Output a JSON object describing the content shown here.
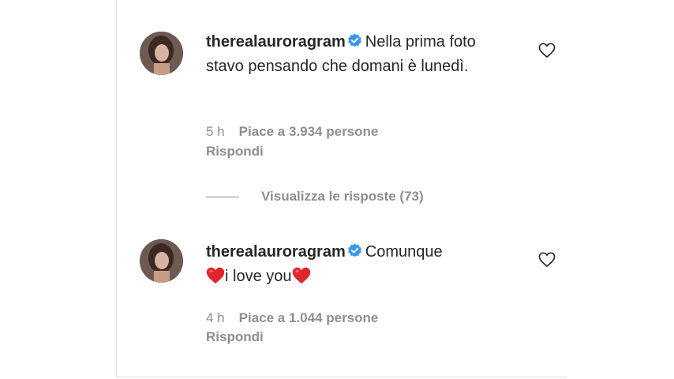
{
  "comments": [
    {
      "username": "therealauroragram",
      "text": "Nella prima foto stavo pensando che domani è lunedì.",
      "time": "5 h",
      "likes": "Piace a 3.934 persone",
      "reply": "Rispondi"
    },
    {
      "username": "therealauroragram",
      "text_before": "Comunque",
      "text_middle": "i love you",
      "time": "4 h",
      "likes": "Piace a 1.044 persone",
      "reply": "Rispondi"
    }
  ],
  "view_replies": "Visualizza le risposte (73)",
  "icons": {
    "verified": "verified-badge-icon",
    "like": "heart-outline-icon",
    "emoji": "red-heart-emoji"
  },
  "colors": {
    "text": "#262626",
    "secondary": "#8e8e8e",
    "verified": "#3897f0",
    "emoji_heart": "#e0262b"
  }
}
